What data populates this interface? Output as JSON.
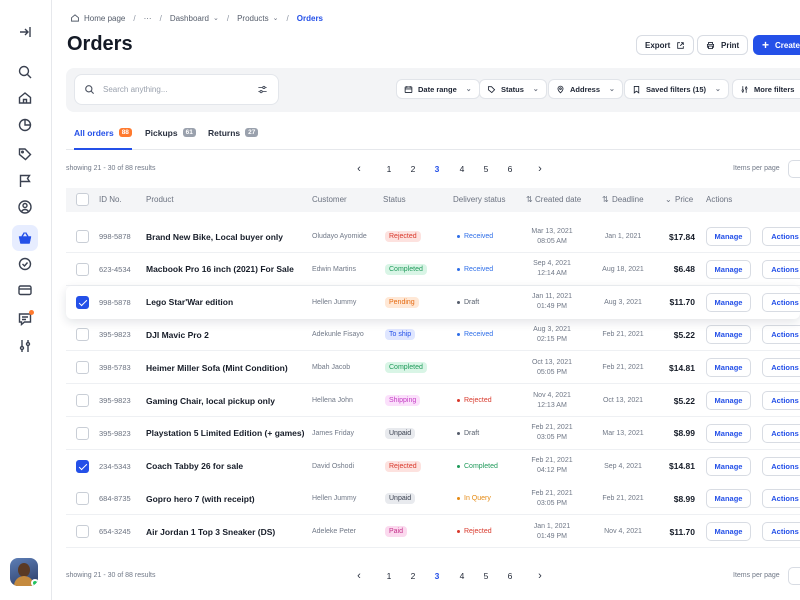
{
  "breadcrumb": {
    "home": "Home page",
    "ellipsis": "···",
    "dashboard": "Dashboard",
    "products": "Products",
    "current": "Orders"
  },
  "header": {
    "title": "Orders",
    "export_label": "Export",
    "print_label": "Print",
    "create_label": "Create o"
  },
  "filters": {
    "search_placeholder": "Search anything...",
    "date_range": "Date range",
    "status": "Status",
    "address": "Address",
    "saved_filters": "Saved filters (15)",
    "more_filters": "More filters"
  },
  "tabs": [
    {
      "label": "All orders",
      "count": "88",
      "active": true
    },
    {
      "label": "Pickups",
      "count": "61",
      "active": false
    },
    {
      "label": "Returns",
      "count": "27",
      "active": false
    }
  ],
  "pagination": {
    "showing": "showing 21 - 30 of 88 results",
    "pages": [
      "1",
      "2",
      "3",
      "4",
      "5",
      "6"
    ],
    "current": "3",
    "prev_icon": "chevron-left-icon",
    "next_icon": "chevron-right-icon",
    "items_per_page_label": "Items per page"
  },
  "table": {
    "columns": {
      "id": "ID No.",
      "product": "Product",
      "customer": "Customer",
      "status": "Status",
      "delivery": "Delivery status",
      "created": "Created date",
      "deadline": "Deadline",
      "price": "Price",
      "actions": "Actions"
    },
    "rows": [
      {
        "checked": false,
        "id": "998-5878",
        "product": "Brand New Bike, Local buyer only",
        "customer": "Oludayo Ayomide",
        "status": "Rejected",
        "delivery": "Received",
        "created": "Mar 13, 2021 08:05 AM",
        "deadline": "Jan 1, 2021",
        "price": "$17.84",
        "manage": "Manage",
        "actions": "Actions"
      },
      {
        "checked": false,
        "id": "623-4534",
        "product": "Macbook Pro 16 inch (2021) For Sale",
        "customer": "Edwin Martins",
        "status": "Completed",
        "delivery": "Received",
        "created": "Sep 4, 2021 12:14 AM",
        "deadline": "Aug 18, 2021",
        "price": "$6.48",
        "manage": "Manage",
        "actions": "Actions"
      },
      {
        "checked": true,
        "id": "998-5878",
        "product": "Lego Star'War edition",
        "customer": "Hellen Jummy",
        "status": "Pending",
        "delivery": "Draft",
        "created": "Jan 11, 2021 01:49 PM",
        "deadline": "Aug 3, 2021",
        "price": "$11.70",
        "manage": "Manage",
        "actions": "Actions"
      },
      {
        "checked": false,
        "id": "395-9823",
        "product": "DJI Mavic Pro 2",
        "customer": "Adekunle Fisayo",
        "status": "To ship",
        "delivery": "Received",
        "created": "Aug 3, 2021 02:15 PM",
        "deadline": "Feb 21, 2021",
        "price": "$5.22",
        "manage": "Manage",
        "actions": "Actions"
      },
      {
        "checked": false,
        "id": "398-5783",
        "product": "Heimer Miller Sofa (Mint Condition)",
        "customer": "Mbah Jacob",
        "status": "Completed",
        "delivery": "",
        "created": "Oct 13, 2021 05:05 PM",
        "deadline": "Feb 21, 2021",
        "price": "$14.81",
        "manage": "Manage",
        "actions": "Actions"
      },
      {
        "checked": false,
        "id": "395-9823",
        "product": "Gaming Chair, local pickup only",
        "customer": "Hellena John",
        "status": "Shipping",
        "delivery": "Rejected",
        "created": "Nov 4, 2021 12:13 AM",
        "deadline": "Oct 13, 2021",
        "price": "$5.22",
        "manage": "Manage",
        "actions": "Actions"
      },
      {
        "checked": false,
        "id": "395-9823",
        "product": "Playstation 5 Limited Edition (+ games)",
        "customer": "James Friday",
        "status": "Unpaid",
        "delivery": "Draft",
        "created": "Feb 21, 2021 03:05 PM",
        "deadline": "Mar 13, 2021",
        "price": "$8.99",
        "manage": "Manage",
        "actions": "Actions"
      },
      {
        "checked": true,
        "id": "234-5343",
        "product": "Coach Tabby 26 for sale",
        "customer": "David Oshodi",
        "status": "Rejected",
        "delivery": "Completed",
        "created": "Feb 21, 2021 04:12 PM",
        "deadline": "Sep 4, 2021",
        "price": "$14.81",
        "manage": "Manage",
        "actions": "Actions"
      },
      {
        "checked": false,
        "id": "684-8735",
        "product": "Gopro hero 7 (with receipt)",
        "customer": "Hellen Jummy",
        "status": "Unpaid",
        "delivery": "In Query",
        "created": "Feb 21, 2021 03:05 PM",
        "deadline": "Feb 21, 2021",
        "price": "$8.99",
        "manage": "Manage",
        "actions": "Actions"
      },
      {
        "checked": false,
        "id": "654-3245",
        "product": "Air Jordan 1 Top 3 Sneaker (DS)",
        "customer": "Adeleke Peter",
        "status": "Paid",
        "delivery": "Rejected",
        "created": "Jan 1, 2021 01:49 PM",
        "deadline": "Nov 4, 2021",
        "price": "$11.70",
        "manage": "Manage",
        "actions": "Actions"
      }
    ]
  },
  "status_colors": {
    "Rejected": {
      "bg": "#fde2df",
      "fg": "#d8382b"
    },
    "Completed": {
      "bg": "#d9f5e6",
      "fg": "#1f9a5a"
    },
    "Pending": {
      "bg": "#ffe8d6",
      "fg": "#e56b13"
    },
    "To ship": {
      "bg": "#dfe6ff",
      "fg": "#2450e8"
    },
    "Shipping": {
      "bg": "#fbe0fb",
      "fg": "#c43bc4"
    },
    "Unpaid": {
      "bg": "#e8eaee",
      "fg": "#3a4150"
    },
    "Paid": {
      "bg": "#fbd9ee",
      "fg": "#c42f8a"
    }
  },
  "delivery_colors": {
    "Received": "#2e6ee8",
    "Draft": "#555d6b",
    "Rejected": "#d8382b",
    "Completed": "#1f9a5a",
    "In Query": "#e58a13"
  },
  "sidebar": {
    "icons": [
      "collapse-icon",
      "search-icon",
      "home-icon",
      "chart-icon",
      "tag-icon",
      "flag-icon",
      "user-icon",
      "basket-icon",
      "check-badge-icon",
      "card-icon",
      "chat-icon",
      "settings-icon"
    ]
  }
}
